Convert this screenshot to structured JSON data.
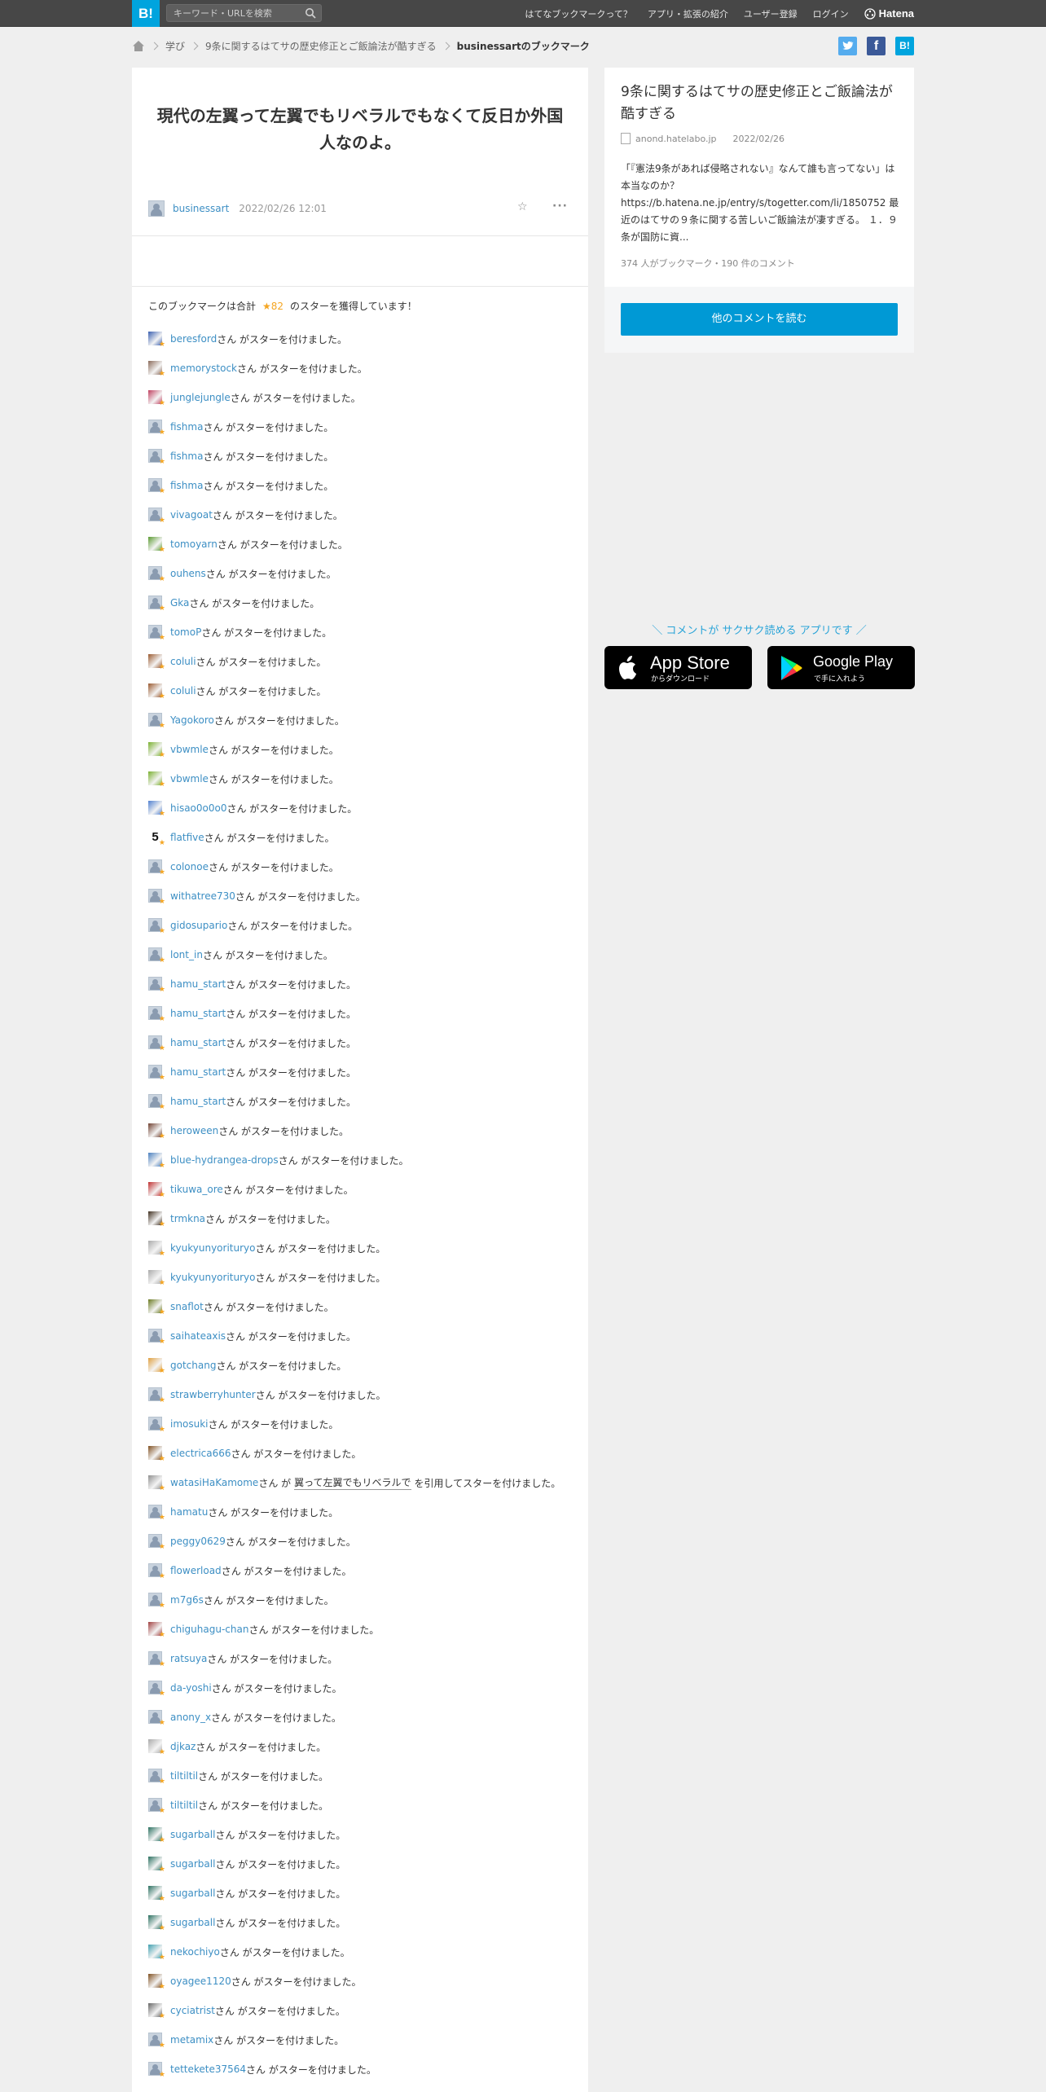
{
  "topbar": {
    "logo": "B!",
    "search_placeholder": "キーワード・URLを検索",
    "nav": [
      "はてなブックマークって？",
      "アプリ・拡張の紹介",
      "ユーザー登録",
      "ログイン"
    ],
    "brand": "Hatena"
  },
  "breadcrumb": [
    "学び",
    "9条に関するはてサの歴史修正とご飯論法が酷すぎる",
    "businessartのブックマーク"
  ],
  "share": {
    "twitter": "t",
    "facebook": "f",
    "hatena": "B!"
  },
  "bookmark": {
    "title": "現代の左翼って左翼でもリベラルでもなくて反日か外国人なのよ。",
    "user": "businessart",
    "date": "2022/02/26 12:01"
  },
  "stars": {
    "summary_before": "このブックマークは合計",
    "count": "★82",
    "summary_after": "のスターを獲得しています！",
    "suffix": "さん がスターを付けました。",
    "quote_prefix": "さん が",
    "quote_suffix": "を引用してスターを付けました。",
    "list": [
      {
        "user": "beresford",
        "avatar": "bird"
      },
      {
        "user": "memorystock",
        "avatar": "pic"
      },
      {
        "user": "junglejungle",
        "avatar": "pic2"
      },
      {
        "user": "fishma",
        "avatar": "default"
      },
      {
        "user": "fishma",
        "avatar": "default"
      },
      {
        "user": "fishma",
        "avatar": "default"
      },
      {
        "user": "vivagoat",
        "avatar": "default"
      },
      {
        "user": "tomoyarn",
        "avatar": "green"
      },
      {
        "user": "ouhens",
        "avatar": "default"
      },
      {
        "user": "Gka",
        "avatar": "default"
      },
      {
        "user": "tomoP",
        "avatar": "default"
      },
      {
        "user": "coluli",
        "avatar": "brown"
      },
      {
        "user": "coluli",
        "avatar": "brown"
      },
      {
        "user": "Yagokoro",
        "avatar": "default"
      },
      {
        "user": "vbwmle",
        "avatar": "lime"
      },
      {
        "user": "vbwmle",
        "avatar": "lime"
      },
      {
        "user": "hisao0o0o0",
        "avatar": "blue"
      },
      {
        "user": "flatfive",
        "avatar": "five"
      },
      {
        "user": "colonoe",
        "avatar": "default"
      },
      {
        "user": "withatree730",
        "avatar": "default"
      },
      {
        "user": "gidosupario",
        "avatar": "default"
      },
      {
        "user": "lont_in",
        "avatar": "default"
      },
      {
        "user": "hamu_start",
        "avatar": "default"
      },
      {
        "user": "hamu_start",
        "avatar": "default"
      },
      {
        "user": "hamu_start",
        "avatar": "default"
      },
      {
        "user": "hamu_start",
        "avatar": "default"
      },
      {
        "user": "hamu_start",
        "avatar": "default"
      },
      {
        "user": "heroween",
        "avatar": "pic3"
      },
      {
        "user": "blue-hydrangea-drops",
        "avatar": "hydrangea"
      },
      {
        "user": "tikuwa_ore",
        "avatar": "red"
      },
      {
        "user": "trmkna",
        "avatar": "dark"
      },
      {
        "user": "kyukyunyorituryo",
        "avatar": "sketch"
      },
      {
        "user": "kyukyunyorituryo",
        "avatar": "sketch"
      },
      {
        "user": "snaflot",
        "avatar": "olive"
      },
      {
        "user": "saihateaxis",
        "avatar": "default"
      },
      {
        "user": "gotchang",
        "avatar": "orange"
      },
      {
        "user": "strawberryhunter",
        "avatar": "default"
      },
      {
        "user": "imosuki",
        "avatar": "default"
      },
      {
        "user": "electrica666",
        "avatar": "pic4"
      },
      {
        "user": "watasiHaKamome",
        "avatar": "gull",
        "quote": "翼って左翼でもリベラルで"
      },
      {
        "user": "hamatu",
        "avatar": "default"
      },
      {
        "user": "peggy0629",
        "avatar": "default"
      },
      {
        "user": "flowerload",
        "avatar": "default"
      },
      {
        "user": "m7g6s",
        "avatar": "default"
      },
      {
        "user": "chiguhagu-chan",
        "avatar": "pic5"
      },
      {
        "user": "ratsuya",
        "avatar": "default"
      },
      {
        "user": "da-yoshi",
        "avatar": "default"
      },
      {
        "user": "anony_x",
        "avatar": "default"
      },
      {
        "user": "djkaz",
        "avatar": "sketch"
      },
      {
        "user": "tiltiltil",
        "avatar": "default"
      },
      {
        "user": "tiltiltil",
        "avatar": "default"
      },
      {
        "user": "sugarball",
        "avatar": "teal"
      },
      {
        "user": "sugarball",
        "avatar": "teal"
      },
      {
        "user": "sugarball",
        "avatar": "teal"
      },
      {
        "user": "sugarball",
        "avatar": "teal"
      },
      {
        "user": "nekochiyo",
        "avatar": "cyan"
      },
      {
        "user": "oyagee1120",
        "avatar": "pic4"
      },
      {
        "user": "cyciatrist",
        "avatar": "figure"
      },
      {
        "user": "metamix",
        "avatar": "default"
      },
      {
        "user": "tettekete37564",
        "avatar": "default"
      }
    ]
  },
  "entry": {
    "title": "9条に関するはてサの歴史修正とご飯論法が酷すぎる",
    "domain": "anond.hatelabo.jp",
    "date": "2022/02/26",
    "description": "「『憲法9条があれば侵略されない』なんて誰も言ってない」は本当なのか？ https://b.hatena.ne.jp/entry/s/togetter.com/li/1850752 最近のはてサの９条に関する苦しいご飯論法が凄すぎる。 １．９条が国防に資...",
    "count": "374 人がブックマーク・190 件のコメント",
    "read_more": "他のコメントを読む"
  },
  "app": {
    "promo": "＼ コメントが サクサク読める アプリです ／",
    "appstore_big": "App Store",
    "appstore_small": "からダウンロード",
    "googleplay_big": "Google Play",
    "googleplay_small": "で手に入れよう"
  },
  "colors": {
    "accent": "#00a4de",
    "link": "#3d8fc4",
    "star": "#f5a623",
    "topbar": "#474747"
  }
}
